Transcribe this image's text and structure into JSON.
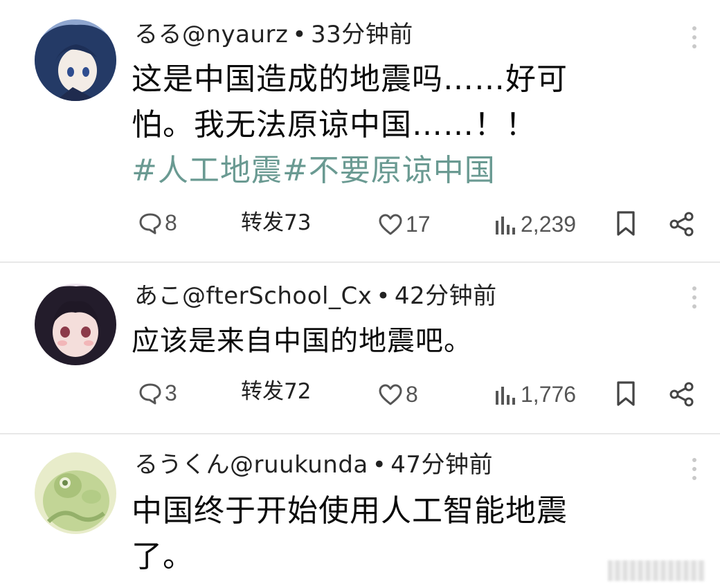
{
  "posts": [
    {
      "name": "るる",
      "handle": "@nyaurz",
      "time": "33分钟前",
      "text_lines": [
        "这是中国造成的地震吗……好可",
        "怕。我无法原谅中国……！！"
      ],
      "hashtags": "#人工地震#不要原谅中国",
      "replies": "8",
      "forward": "转发73",
      "likes": "17",
      "views": "2,239",
      "avatar_colors": [
        "#2a3f6a",
        "#6e8ec2"
      ]
    },
    {
      "name": "あこ",
      "handle": "@fterSchool_Cx",
      "time": "42分钟前",
      "text_lines": [
        "应该是来自中国的地震吧。"
      ],
      "hashtags": "",
      "replies": "3",
      "forward": "转发72",
      "likes": "8",
      "views": "1,776",
      "avatar_colors": [
        "#2a2030",
        "#e8c9c4"
      ]
    },
    {
      "name": "るうくん",
      "handle": "@ruukunda",
      "time": "47分钟前",
      "text_lines": [
        "中国终于开始使用人工智能地震",
        "了。"
      ],
      "hashtags": "",
      "avatar_colors": [
        "#b9cf8c",
        "#e9eccf"
      ]
    }
  ],
  "separator": "•",
  "icons": {
    "reply": "speech-bubble-icon",
    "like": "heart-icon",
    "views": "bar-chart-icon",
    "bookmark": "bookmark-icon",
    "share": "share-icon",
    "more": "kebab-menu-icon"
  },
  "colors": {
    "hashtag": "#6a9a92",
    "icon": "#555555",
    "divider": "#e8e8e8"
  }
}
